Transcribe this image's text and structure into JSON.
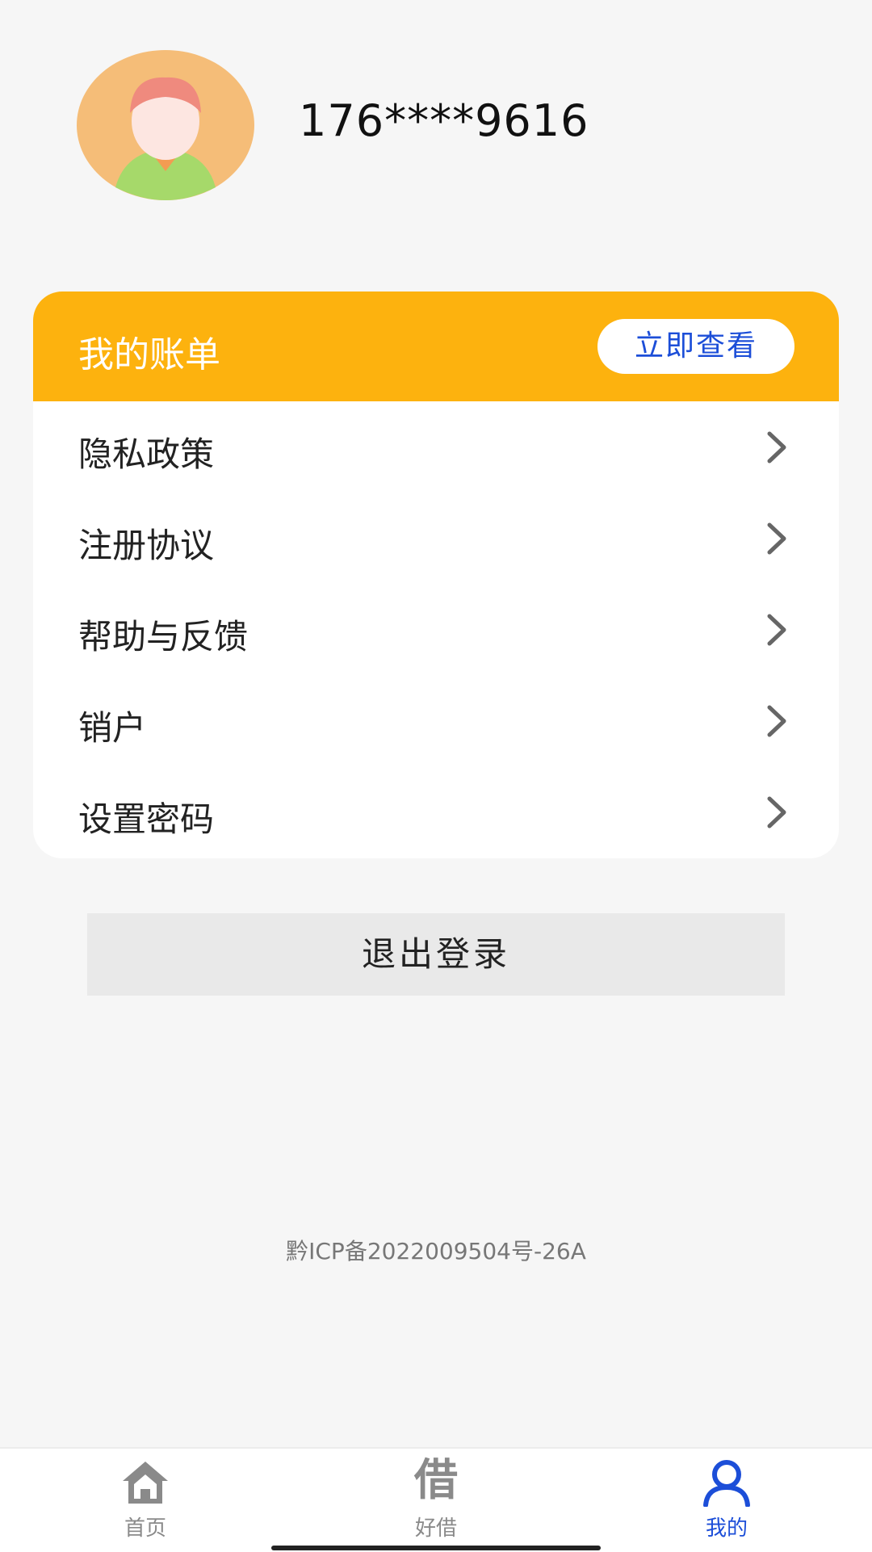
{
  "profile": {
    "phone": "176****9616"
  },
  "bill_card": {
    "title": "我的账单",
    "view_button": "立即查看"
  },
  "menu": {
    "items": [
      {
        "label": "隐私政策"
      },
      {
        "label": "注册协议"
      },
      {
        "label": "帮助与反馈"
      },
      {
        "label": "销户"
      },
      {
        "label": "设置密码"
      }
    ]
  },
  "logout": {
    "label": "退出登录"
  },
  "footer": {
    "icp": "黔ICP备2022009504号-26A"
  },
  "tabbar": {
    "tabs": [
      {
        "label": "首页",
        "icon": "home-icon"
      },
      {
        "label": "好借",
        "icon": "borrow-icon",
        "glyph": "借"
      },
      {
        "label": "我的",
        "icon": "user-icon"
      }
    ],
    "active_index": 2
  },
  "colors": {
    "accent": "#fdb20e",
    "active_blue": "#1c4ed8",
    "inactive_gray": "#8a8a8a"
  }
}
